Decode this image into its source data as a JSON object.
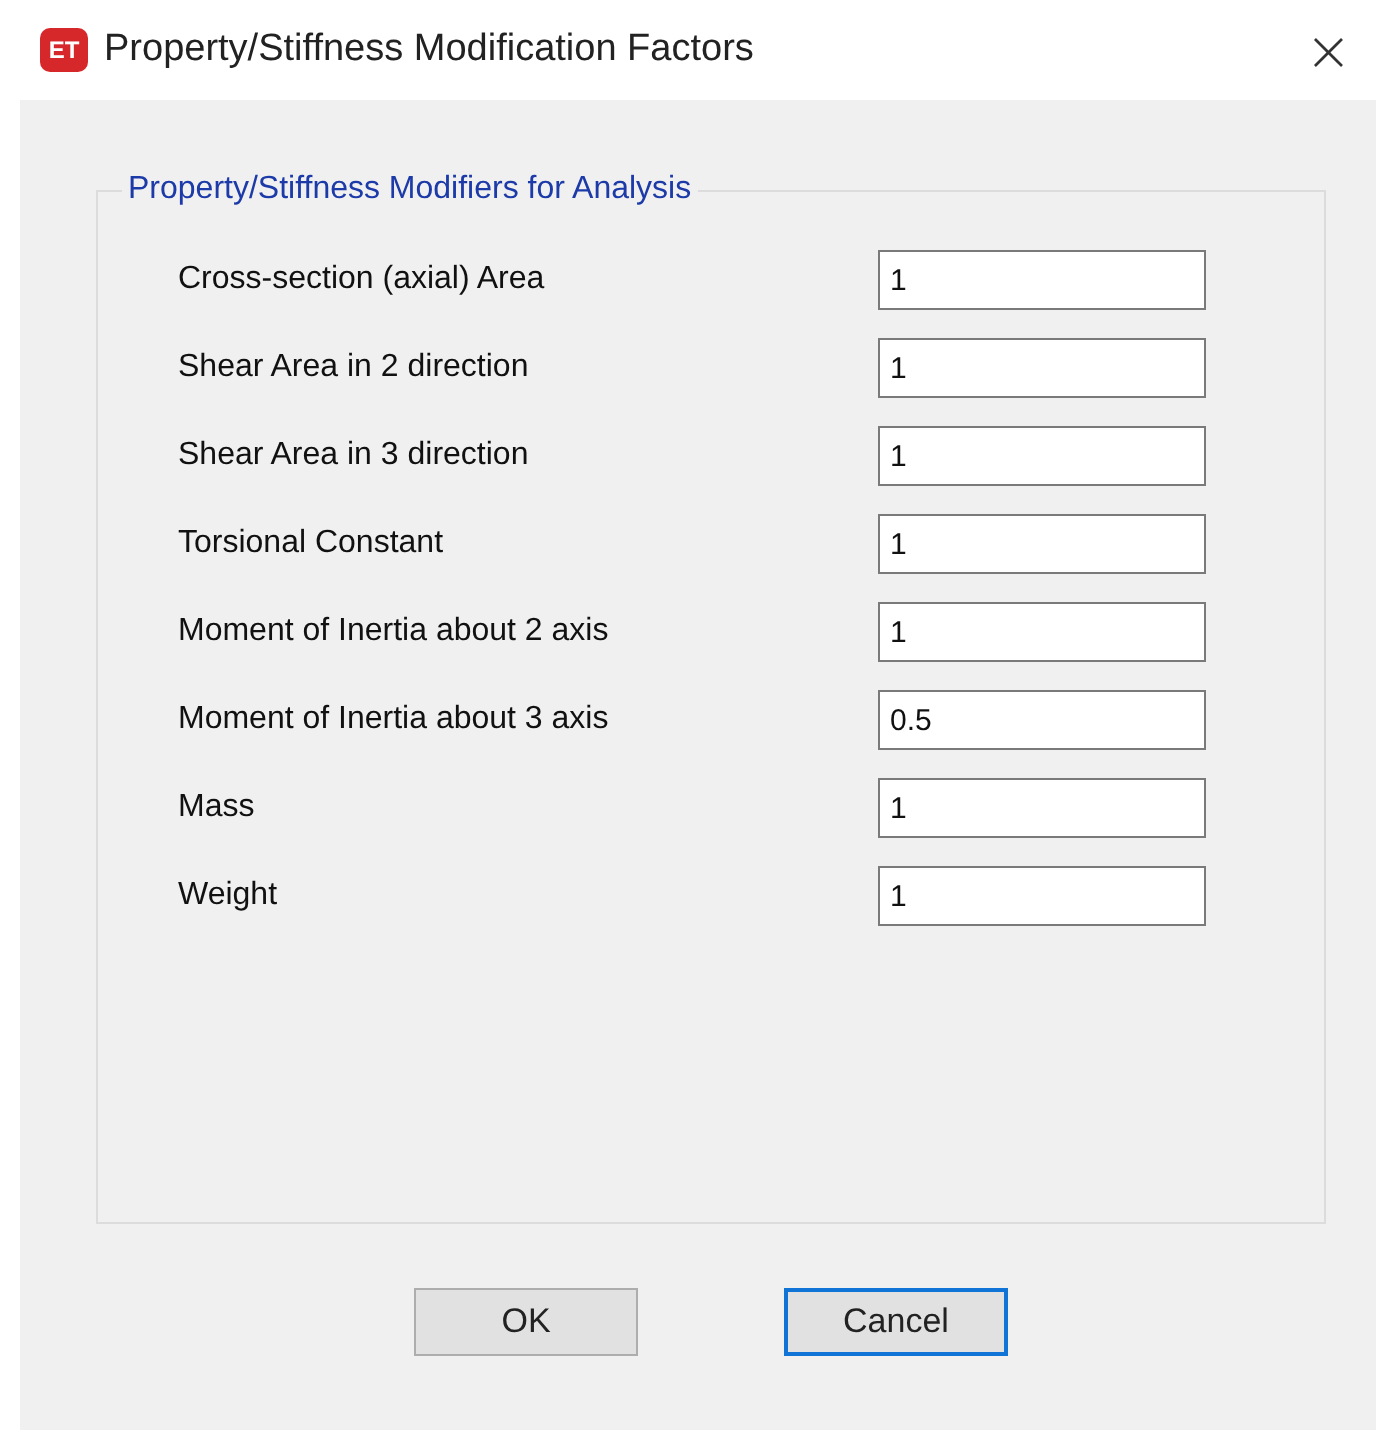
{
  "window": {
    "title": "Property/Stiffness Modification Factors",
    "app_badge": "ET",
    "close": "×"
  },
  "group": {
    "title": "Property/Stiffness Modifiers for Analysis",
    "fields": [
      {
        "label": "Cross-section (axial) Area",
        "value": "1"
      },
      {
        "label": "Shear Area in 2 direction",
        "value": "1"
      },
      {
        "label": "Shear Area in 3 direction",
        "value": "1"
      },
      {
        "label": "Torsional Constant",
        "value": "1"
      },
      {
        "label": "Moment of Inertia about 2 axis",
        "value": "1"
      },
      {
        "label": "Moment of Inertia about 3 axis",
        "value": "0.5"
      },
      {
        "label": "Mass",
        "value": "1"
      },
      {
        "label": "Weight",
        "value": "1"
      }
    ]
  },
  "buttons": [
    {
      "label": "OK",
      "focused": false
    },
    {
      "label": "Cancel",
      "focused": true
    }
  ]
}
